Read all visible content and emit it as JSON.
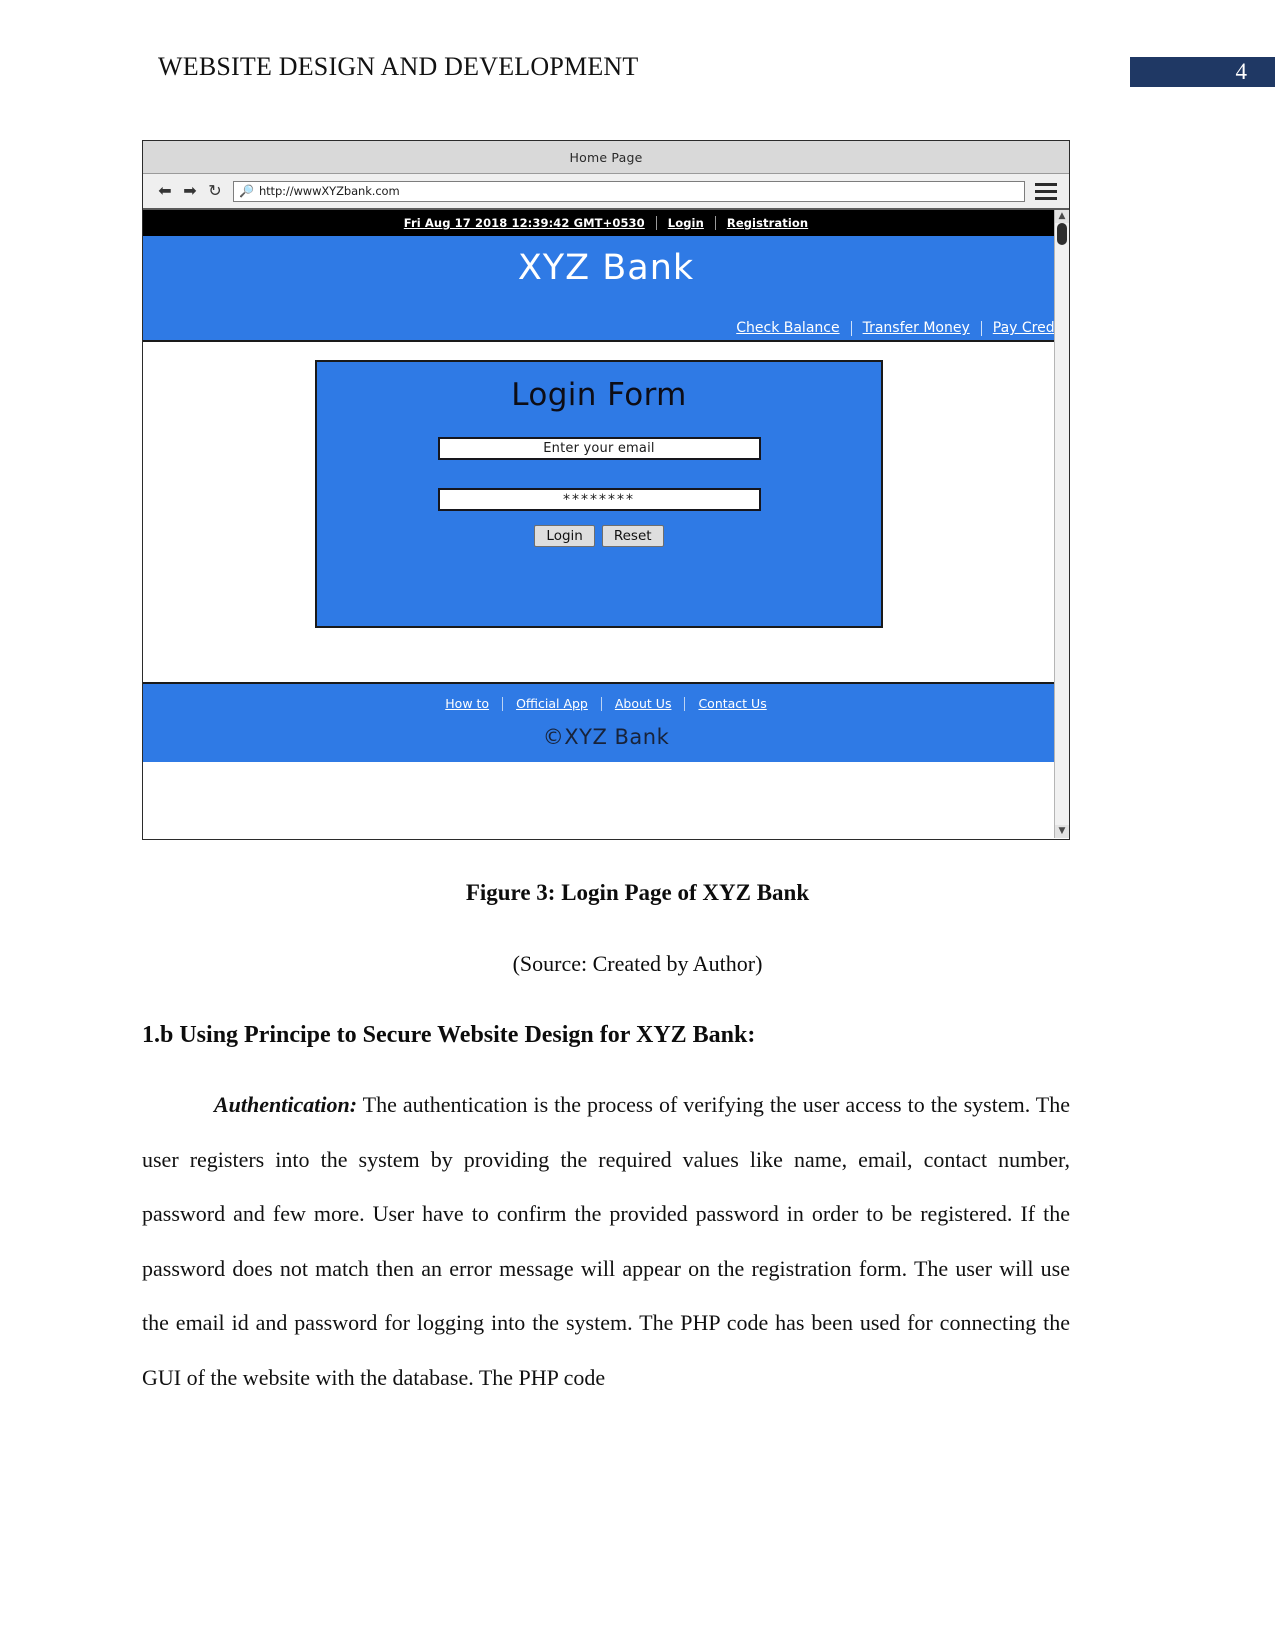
{
  "header": {
    "title": "WEBSITE DESIGN AND DEVELOPMENT",
    "page_number": "4",
    "badge_color": "#1f3864"
  },
  "figure": {
    "browser": {
      "window_title": "Home Page",
      "toolbar": {
        "back_icon": "back-arrow-icon",
        "forward_icon": "forward-arrow-icon",
        "reload_icon": "reload-icon",
        "search_icon": "search-icon",
        "menu_icon": "hamburger-menu-icon",
        "url": "http://wwwXYZbank.com"
      },
      "scrollbar": {
        "up_arrow": "▲",
        "down_arrow": "▼"
      }
    },
    "site": {
      "topbar": {
        "datetime": "Fri Aug 17 2018 12:39:42 GMT+0530",
        "login": "Login",
        "registration": "Registration"
      },
      "brand": "XYZ Bank",
      "nav_links": [
        "Check Balance",
        "Transfer Money",
        "Pay Credit"
      ],
      "login_form": {
        "title": "Login Form",
        "email_value": "Enter your email",
        "email_placeholder": "Enter your email",
        "password_value": "********",
        "login_button": "Login",
        "reset_button": "Reset"
      },
      "footer": {
        "links": [
          "How to",
          "Official App",
          "About Us",
          "Contact Us"
        ],
        "copyright": "©XYZ Bank"
      },
      "accent_color": "#2f7ae5"
    },
    "caption": "Figure 3: Login Page of XYZ Bank",
    "source": "(Source: Created by Author)"
  },
  "content": {
    "section_heading": "1.b Using Principe to Secure Website Design for XYZ Bank:",
    "paragraph_lead": "Authentication:",
    "paragraph_text": " The authentication is the process of verifying the user access to the system. The user registers into the system by providing the required values like name, email, contact number, password and few more. User have to confirm the provided password in order to be registered. If the password does not match then an error message will appear on the registration form. The user will use the email id and password for logging into the system. The PHP code has been used for connecting the GUI of the website with the database. The PHP code"
  }
}
